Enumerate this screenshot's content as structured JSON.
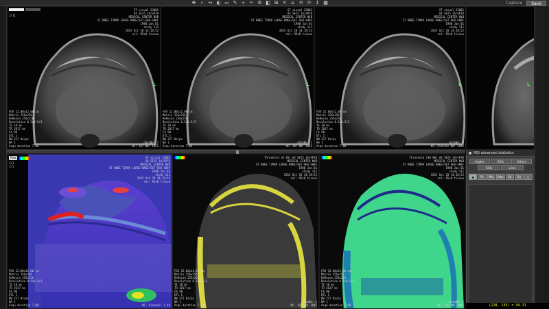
{
  "toolbar": {
    "tools": [
      "✥",
      "⌕",
      "↔",
      "◐",
      "▭",
      "✎",
      "⌖",
      "✂",
      "⚙",
      "◧",
      "⊞",
      "✕",
      "⌂",
      "⟲",
      "⟳",
      "↕",
      "▦"
    ],
    "capture_label": "Capture",
    "save_label": "Save"
  },
  "viewports_top": [
    {
      "tr": "ST visual 23001\nAX SE25 1A/SPIR\nMEDICAL CENTER NVB\nST KNEE T2MAP LARGE KNEE/SE7-SH4-SHBF\n1980 Jan 01\nstudy 111\n2015 Oct 28 14:18:52\ncol: 95x8 tissue",
      "tl": "1/11",
      "bl": "FOV 12.00x12.00 cm\nMatrix 256x256\nReRecon 256x256\nResolution 0.5x0.5/3\nTE 10 ms\nTR 2017 ms\nFA 90\nETL 1\nBW 217 Hz/px\nNA 1\nAcqu duration 7.00",
      "br": "dataNo: 1\nWC: 107 WW: 1045",
      "scale": "10 cm"
    },
    {
      "tr": "ST visual 23001\nAX SE25 1A/SPIR\nMEDICAL CENTER NVB\nST KNEE T2MAP LARGE KNEE/SE7-SH4-SHBF\n1980 Jan 01\nstudy 111\n2015 Oct 28 14:18:52\ncol: 95x8 tissue",
      "tl": "",
      "bl": "FOV 12.00x12.00 cm\nMatrix 256x256\nReRecon 256x256\nResolution 0.5x0.5/3\nTE 20 ms\nTR 2017 ms\nFA 90\nETL 1\nBW 217 Hz/px\nNA 1\nAcqu duration 7.00",
      "br": "dataNo: 2\nWC: 107 WW: 1045",
      "scale": "10 cm"
    },
    {
      "tr": "ST visual 23001\nAX SE25 1A/SPIR\nMEDICAL CENTER NVB\nST KNEE T2MAP LARGE KNEE/SE7-SH4-SHBF\n1980 Jan 01\nstudy 111\n2015 Oct 28 14:18:52\ncol: 95x8 tissue",
      "tl": "",
      "bl": "FOV 12.00x12.00 cm\nMatrix 256x256\nReRecon 256x256\nResolution 0.5x0.5/3\nTE 30 ms\nTR 2017 ms\nFA 90\nETL 1\nBW 217 Hz/px\nNA 1\nAcqu duration 7.00",
      "br": "dataNo: 3\nWC: Elastic WW: 1045",
      "scale": "10 cm"
    }
  ],
  "viewports_bottom": [
    {
      "label": "Raw",
      "tr": "ST visual 23001\nAX SE25 1A/SPIR\nMEDICAL CENTER NVB\nST KNEE T2MAP LARGE KNEE/SE7-SH4-SHBF\n1980 Jan 01\nstudy 111\n2015 Oct 28 14:18:52\ncol: 95x8 tissue",
      "tl": "1/1\n1/1",
      "bl": "FOV 12.00x12.00 cm\nMatrix 256x256\nReRecon 256x256\nResolution 0.5x0.5/3\nTE 10 ms\nTR 2017 ms\nFA 90\nETL 1\nBW 217 Hz/px\nNA 1\nAcqu duration 7.00",
      "br": "WC: biomark: 1.40"
    },
    {
      "label": "",
      "tr": "Threshold [0 40] AX SE25 1A/SPIR\nMEDICAL CENTER NVB\nST KNEE T2MAP LARGE KNEE/SE7-SH4-SHBF\n1980 Jan 01\nstudy 111\n2015 Oct 28 14:18:52\ncol: 95x8 tissue",
      "tl": "",
      "bl": "FOV 12.00x12.00 cm\nMatrix 256x256\nReRecon 256x256\nResolution 0.5x0.5/3\nTE 10 ms\nTR 2017 ms\nFA 90\nETL 1\nBW 217 Hz/px\nNA 1\nAcqu duration 7.00",
      "br": "dataNo: 1\nWC: 107 WW: 1045"
    },
    {
      "label": "",
      "tr": "Threshold [40 80] AX SE25 1A/SPIR\nMEDICAL CENTER NVB\nST KNEE T2MAP LARGE KNEE/SE7-SH4-SHBF\n1980 Jan 01\nstudy 111\n2015 Oct 28 14:18:52\ncol: 95x8 tissue",
      "tl": "",
      "bl": "FOV 12.00x12.00 cm\nMatrix 256x256\nReRecon 256x256\nResolution 0.5x0.5/3\nTE 10 ms\nTR 2017 ms\nFA 90\nETL 1\nBW 217 Hz/px\nNA 1\nAcqu duration 7.00",
      "br": "dataNo: 1\nWC: 107 WW: 1045"
    }
  ],
  "panel": {
    "title": "ROI advanced statistics",
    "tabs_row1": [
      "Angles",
      "ROIs",
      "Others"
    ],
    "tabs_row2": [
      "ROIs",
      "Lines"
    ],
    "stat_buttons": [
      "▲",
      "M.",
      "Min",
      "Max",
      "Sd",
      "Su",
      "◻"
    ]
  },
  "status": {
    "coords": "(128, 135) = 94.31"
  },
  "colors": {
    "panel_bg": "#3a3a3a",
    "threshold_yellow": "#d8d640",
    "threshold_green": "#3fd68c",
    "t2map_blue": "#3a36c8"
  }
}
